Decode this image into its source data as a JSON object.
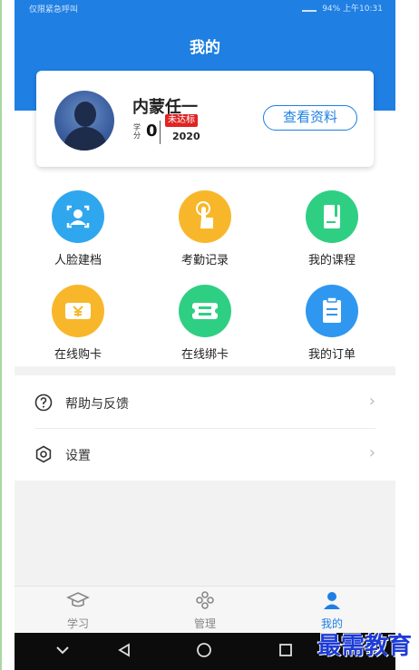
{
  "status_bar": {
    "carrier": "仅限紧急呼叫",
    "right_text": "94% 上午10:31"
  },
  "header": {
    "title": "我的"
  },
  "profile": {
    "name": "内蒙任一",
    "credit_label": "学分",
    "credit_value": "0",
    "badge": "未达标",
    "year": "2020",
    "view_button": "查看资料"
  },
  "grid": [
    {
      "label": "人脸建档",
      "icon": "face-scan-icon",
      "color": "#2fa7ef"
    },
    {
      "label": "考勤记录",
      "icon": "tap-hand-icon",
      "color": "#f8b72a"
    },
    {
      "label": "我的课程",
      "icon": "notebook-icon",
      "color": "#2fcf83"
    },
    {
      "label": "在线购卡",
      "icon": "yen-ticket-icon",
      "color": "#f8b72a"
    },
    {
      "label": "在线绑卡",
      "icon": "card-bind-icon",
      "color": "#2fcf83"
    },
    {
      "label": "我的订单",
      "icon": "clipboard-icon",
      "color": "#2f97ef"
    }
  ],
  "menu": [
    {
      "label": "帮助与反馈",
      "icon": "help-circle-icon"
    },
    {
      "label": "设置",
      "icon": "settings-gear-icon"
    }
  ],
  "tabs": [
    {
      "label": "学习",
      "icon": "graduation-cap-icon"
    },
    {
      "label": "管理",
      "icon": "puzzle-icon"
    },
    {
      "label": "我的",
      "icon": "person-icon",
      "active": true
    }
  ],
  "watermark": "最需教育",
  "colors": {
    "brand_blue": "#1f7fe3",
    "badge_red": "#e02323"
  }
}
